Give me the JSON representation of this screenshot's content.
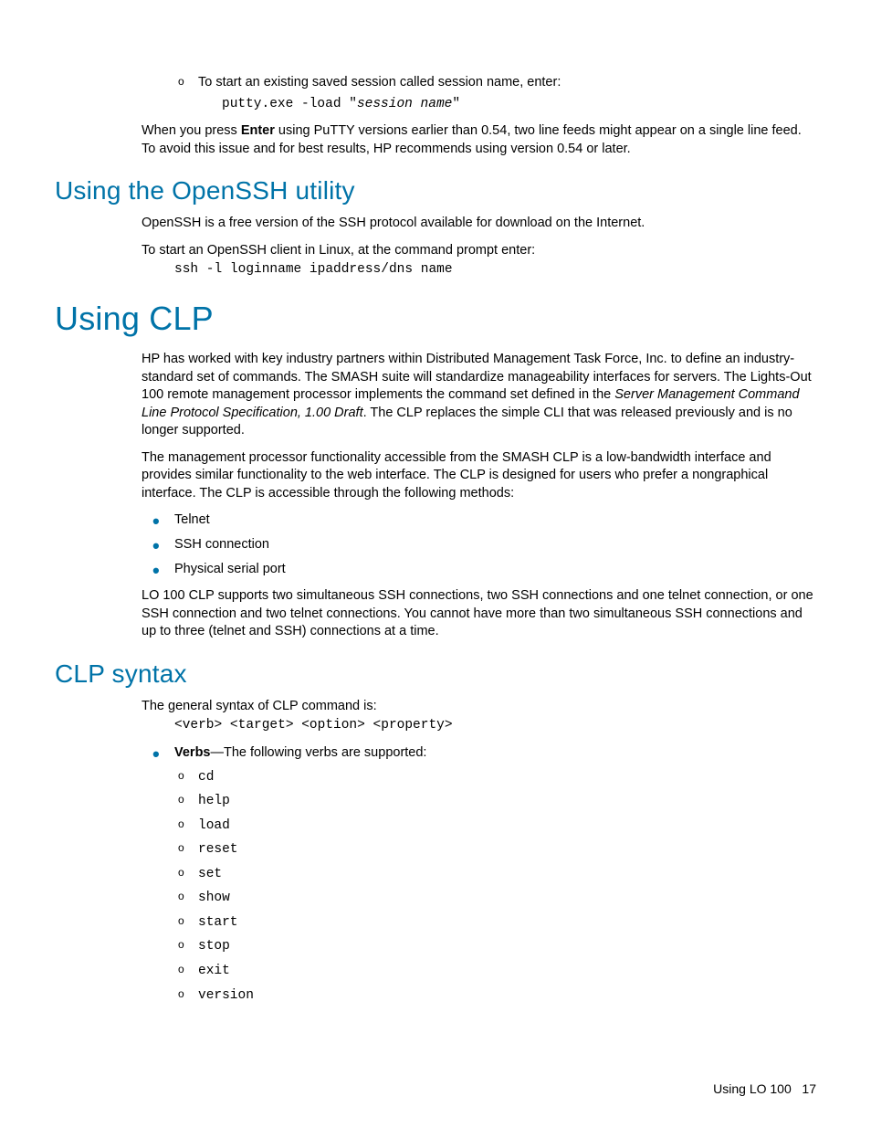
{
  "intro_bullet_text": "To start an existing saved session called session name, enter:",
  "intro_code_prefix": "putty.exe -load \"",
  "intro_code_session": "session name",
  "intro_code_suffix": "\"",
  "enter_para_prefix": "When you press ",
  "enter_bold": "Enter",
  "enter_para_suffix": " using PuTTY versions earlier than 0.54, two line feeds might appear on a single line feed. To avoid this issue and for best results, HP recommends using version 0.54 or later.",
  "h2_openssh": "Using the OpenSSH utility",
  "openssh_p1": "OpenSSH is a free version of the SSH protocol available for download on the Internet.",
  "openssh_p2": "To start an OpenSSH client in Linux, at the command prompt enter:",
  "openssh_code": "ssh -l loginname ipaddress/dns name",
  "h1_clp": "Using CLP",
  "clp_p1a": "HP has worked with key industry partners within Distributed Management Task Force, Inc. to define an industry-standard set of commands. The SMASH suite will standardize manageability interfaces for servers. The Lights-Out 100 remote management processor implements the command set defined in the ",
  "clp_p1_italic": "Server Management Command Line Protocol Specification, 1.00 Draft",
  "clp_p1b": ". The CLP replaces the simple CLI that was released previously and is no longer supported.",
  "clp_p2": "The management processor functionality accessible from the SMASH CLP is a low-bandwidth interface and provides similar functionality to the web interface. The CLP is designed for users who prefer a nongraphical interface. The CLP is accessible through the following methods:",
  "clp_methods": [
    "Telnet",
    "SSH connection",
    "Physical serial port"
  ],
  "clp_p3": "LO 100 CLP supports two simultaneous SSH connections, two SSH connections and one telnet connection, or one SSH connection and two telnet connections. You cannot have more than two simultaneous SSH connections and up to three (telnet and SSH) connections at a time.",
  "h2_syntax": "CLP syntax",
  "syntax_p1": "The general syntax of CLP command is:",
  "syntax_code": "<verb> <target> <option> <property>",
  "verbs_label": "Verbs",
  "verbs_suffix": "—The following verbs are supported:",
  "verbs": [
    "cd",
    "help",
    "load",
    "reset",
    "set",
    "show",
    "start",
    "stop",
    "exit",
    "version"
  ],
  "footer_text": "Using LO 100",
  "footer_page": "17"
}
